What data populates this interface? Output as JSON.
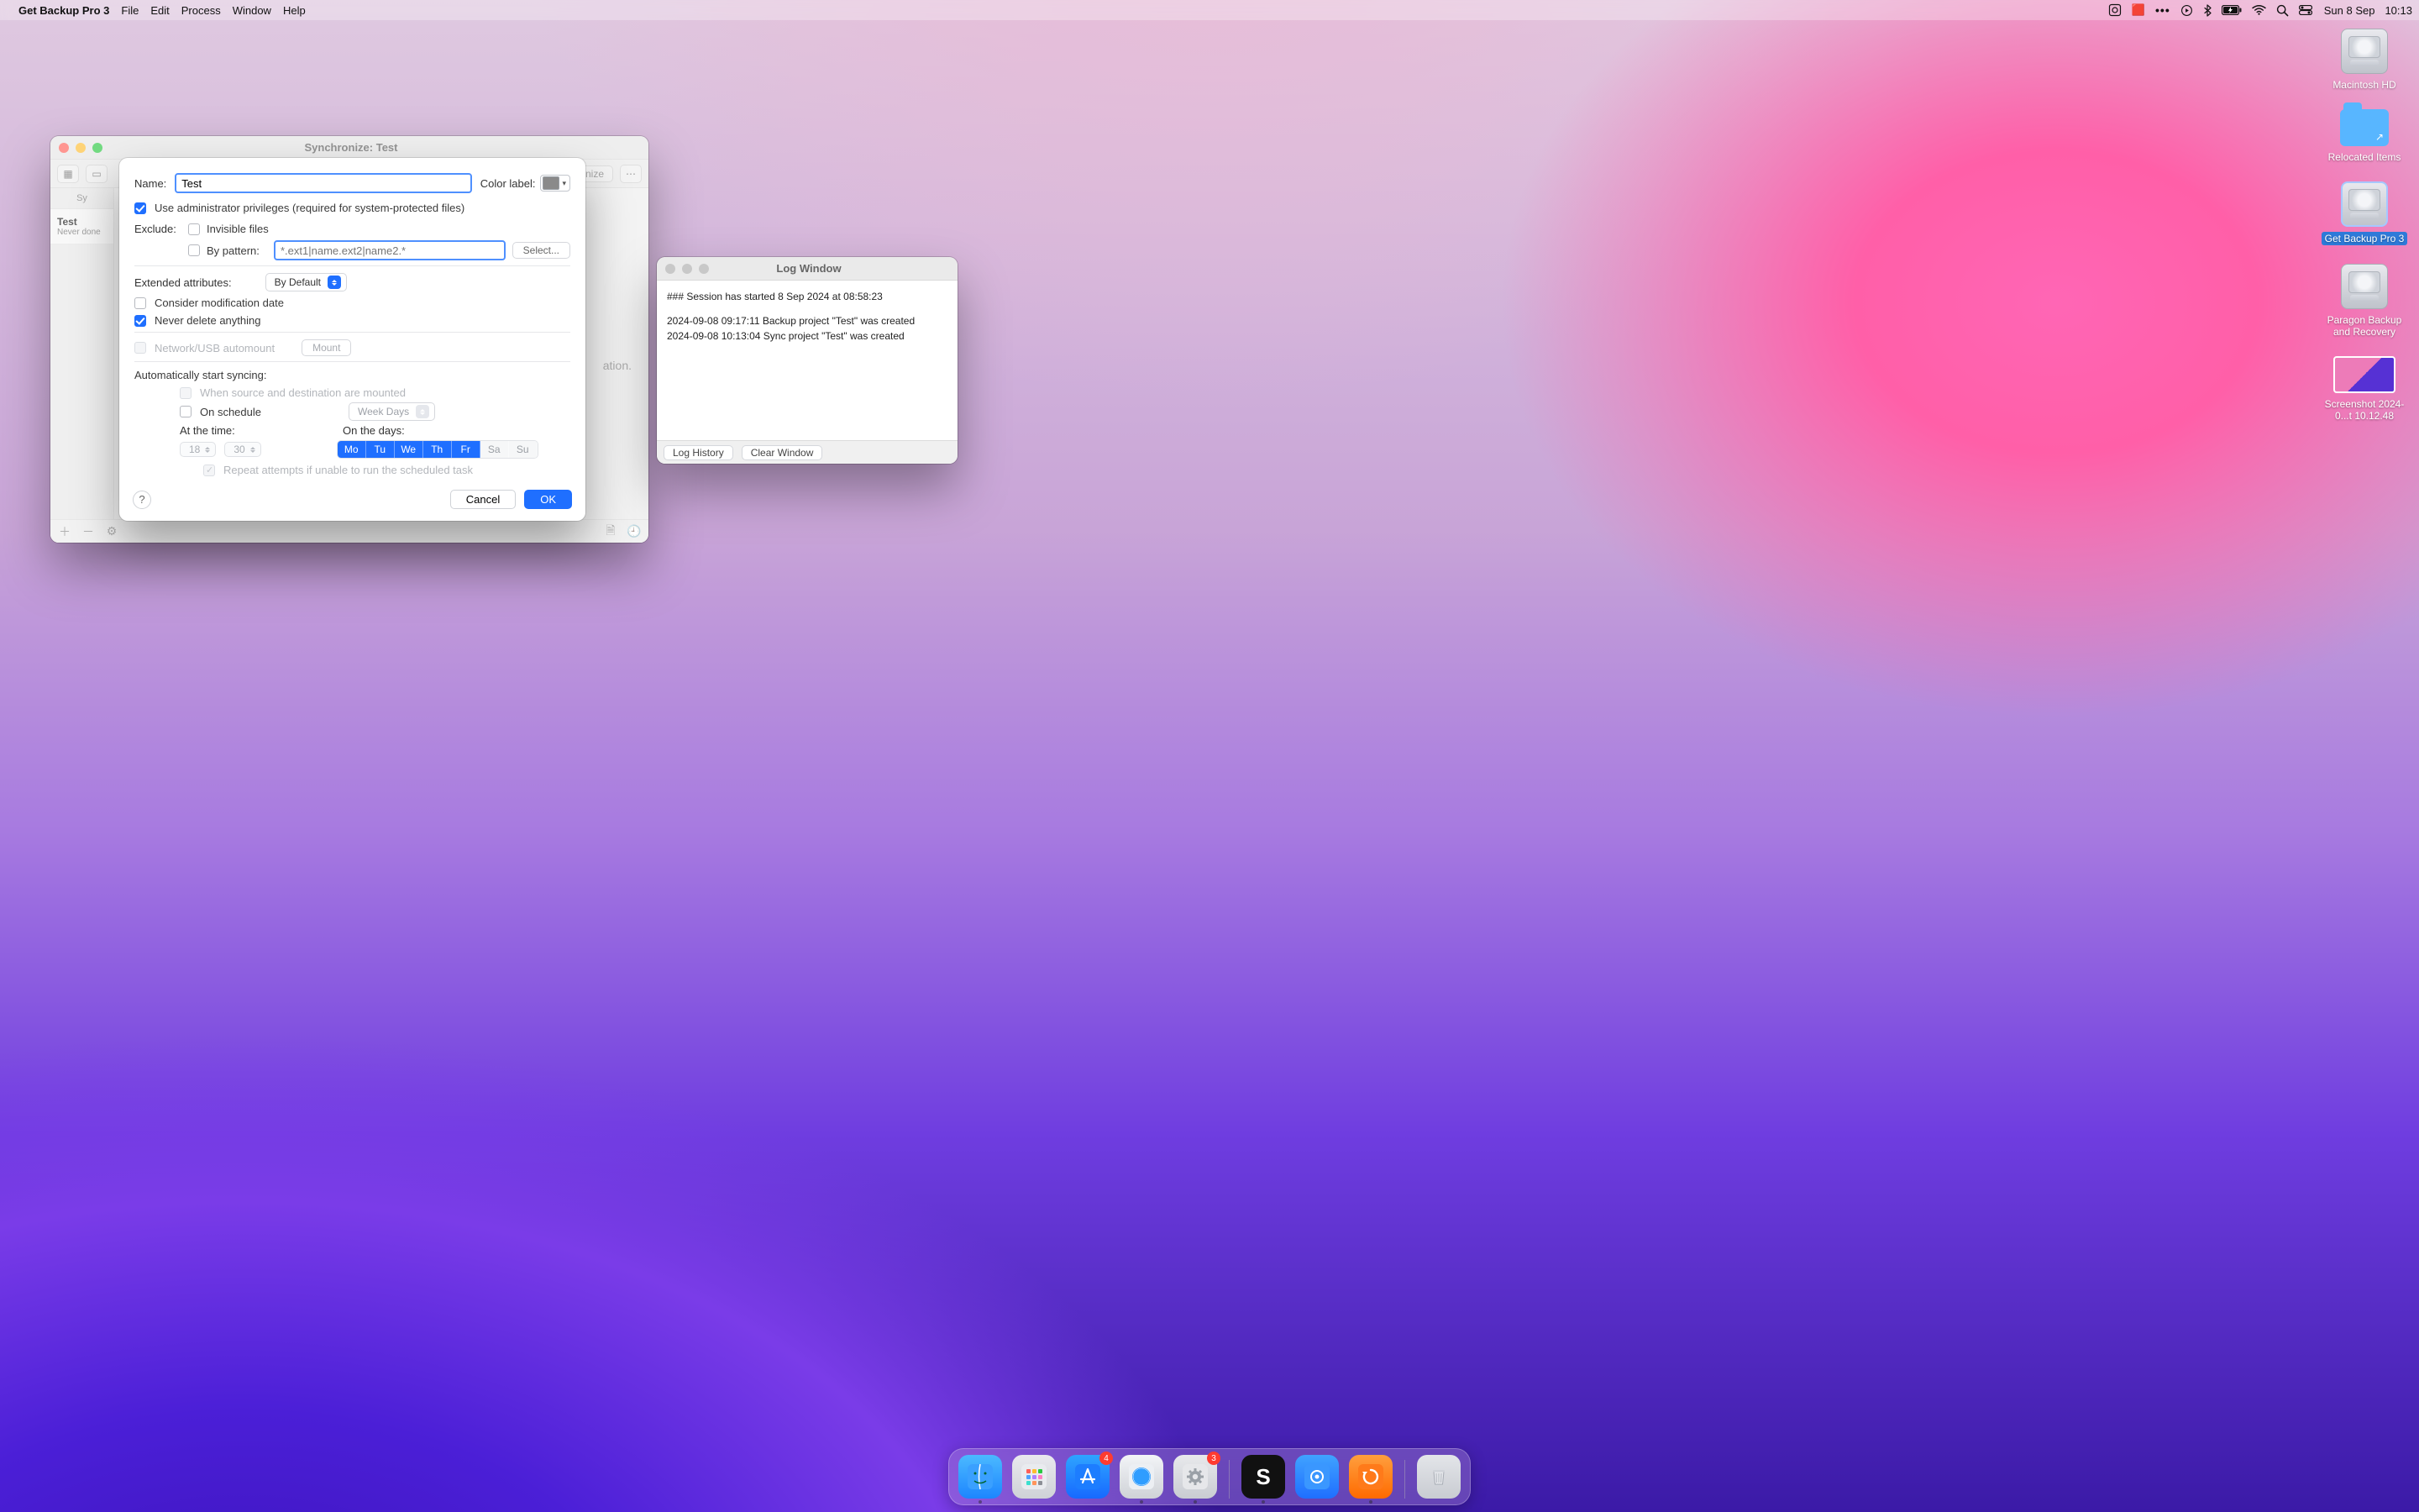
{
  "menu": {
    "app_name": "Get Backup Pro 3",
    "items": [
      "File",
      "Edit",
      "Process",
      "Window",
      "Help"
    ],
    "date": "Sun 8 Sep",
    "time": "10:13"
  },
  "desktop": {
    "hd": "Macintosh HD",
    "relocated": "Relocated Items",
    "getbackup": "Get Backup Pro 3",
    "paragon": "Paragon Backup and Recovery",
    "screenshot": "Screenshot 2024-0...t 10.12.48"
  },
  "app_window": {
    "title": "Synchronize: Test",
    "sidebar_header": "Sy",
    "row_name": "Test",
    "row_sub": "Never done",
    "synchronize_btn": "nize",
    "main_placeholder": "ation."
  },
  "sheet": {
    "name_label": "Name:",
    "name_value": "Test",
    "color_label": "Color label:",
    "admin_label": "Use administrator privileges (required for system-protected files)",
    "exclude_label": "Exclude:",
    "invisible_label": "Invisible files",
    "bypattern_label": "By pattern:",
    "pattern_placeholder": "*.ext1|name.ext2|name2.*",
    "select_btn": "Select...",
    "ea_label": "Extended attributes:",
    "ea_value": "By Default",
    "mod_label": "Consider modification date",
    "neverdel_label": "Never delete anything",
    "netusb_label": "Network/USB automount",
    "mount_btn": "Mount",
    "autostart_label": "Automatically start syncing:",
    "whenmounted_label": "When source and destination are mounted",
    "onschedule_label": "On schedule",
    "weekdays_value": "Week Days",
    "atthetime_label": "At the time:",
    "hour": "18",
    "minute": "30",
    "onthedays_label": "On the days:",
    "days": [
      {
        "abbr": "Mo",
        "on": true
      },
      {
        "abbr": "Tu",
        "on": true
      },
      {
        "abbr": "We",
        "on": true
      },
      {
        "abbr": "Th",
        "on": true
      },
      {
        "abbr": "Fr",
        "on": true
      },
      {
        "abbr": "Sa",
        "on": false
      },
      {
        "abbr": "Su",
        "on": false
      }
    ],
    "repeat_label": "Repeat attempts if unable to run the scheduled task",
    "cancel": "Cancel",
    "ok": "OK",
    "help": "?"
  },
  "log": {
    "title": "Log Window",
    "line1": "###  Session has started 8 Sep 2024 at 08:58:23",
    "line2": "2024-09-08 09:17:11 Backup project \"Test\" was created",
    "line3": "2024-09-08 10:13:04 Sync project \"Test\" was created",
    "history": "Log History",
    "clear": "Clear Window"
  },
  "dock": {
    "appstore_badge": "4",
    "settings_badge": "3"
  }
}
